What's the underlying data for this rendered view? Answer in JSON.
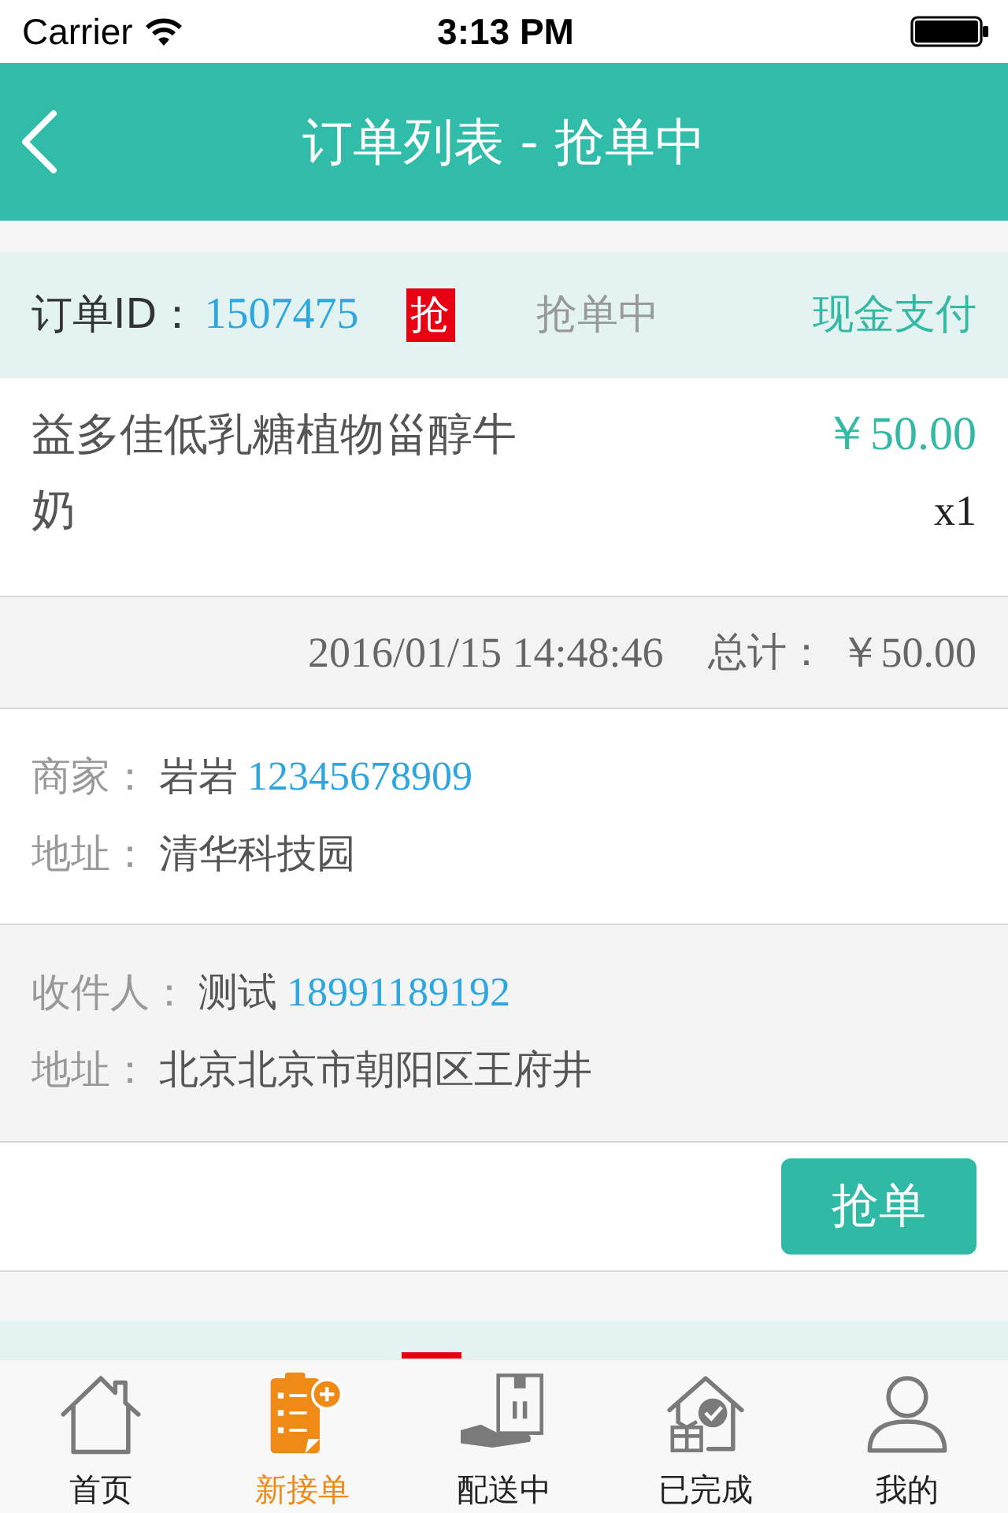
{
  "status_bar": {
    "carrier": "Carrier",
    "time": "3:13 PM"
  },
  "nav_bar": {
    "title": "订单列表 - 抢单中"
  },
  "orders": [
    {
      "id_label": "订单ID：",
      "id": "1507475",
      "badge": "抢",
      "status": "抢单中",
      "payment": "现金支付",
      "items": [
        {
          "name": "益多佳低乳糖植物甾醇牛奶",
          "price": "￥50.00",
          "quantity": "x1"
        }
      ],
      "time": "2016/01/15 14:48:46",
      "total_label": "总计：",
      "total": "￥50.00",
      "merchant": {
        "label": "商家：",
        "name": "岩岩",
        "phone": "12345678909",
        "address_label": "地址：",
        "address": "清华科技园"
      },
      "recipient": {
        "label": "收件人：",
        "name": "测试",
        "phone": "18991189192",
        "address_label": "地址：",
        "address": "北京北京市朝阳区王府井"
      },
      "action": "抢单"
    }
  ],
  "tab_bar": [
    {
      "label": "首页",
      "selected": false
    },
    {
      "label": "新接单",
      "selected": true
    },
    {
      "label": "配送中",
      "selected": false
    },
    {
      "label": "已完成",
      "selected": false
    },
    {
      "label": "我的",
      "selected": false
    }
  ]
}
